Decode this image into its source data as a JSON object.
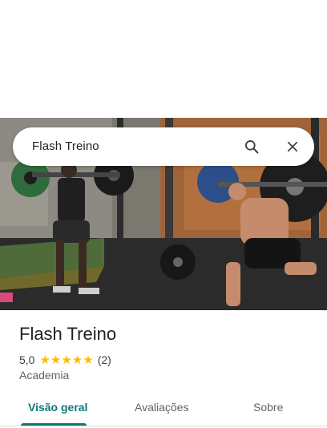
{
  "search": {
    "query": "Flash Treino",
    "search_icon": "search-icon",
    "close_icon": "close-icon"
  },
  "photo": {
    "description_icon": "gym-photo"
  },
  "place": {
    "name": "Flash Treino",
    "rating": "5,0",
    "stars": [
      "★",
      "★",
      "★",
      "★",
      "★"
    ],
    "review_count": "(2)",
    "category": "Academia"
  },
  "tabs": [
    {
      "label": "Visão geral",
      "active": true
    },
    {
      "label": "Avaliações",
      "active": false
    },
    {
      "label": "Sobre",
      "active": false
    }
  ],
  "colors": {
    "accent": "#0b7a76",
    "star": "#fbbc04",
    "text": "#202124",
    "secondary_text": "#5f6368"
  }
}
